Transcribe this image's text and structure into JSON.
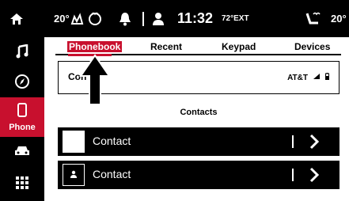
{
  "status": {
    "temp_left": "20°",
    "time": "11:32",
    "ext_temp": "72°EXT",
    "temp_right": "20°"
  },
  "sidebar": {
    "items": [
      {
        "icon": "music-note-icon",
        "label": ""
      },
      {
        "icon": "compass-icon",
        "label": ""
      },
      {
        "icon": "phone-icon",
        "label": "Phone",
        "active": true
      },
      {
        "icon": "car-icon",
        "label": ""
      },
      {
        "icon": "grid-icon",
        "label": ""
      }
    ]
  },
  "tabs": [
    "Phonebook",
    "Recent",
    "Keypad",
    "Devices"
  ],
  "device": {
    "name": "Con",
    "carrier": "AT&T"
  },
  "contacts": {
    "header": "Contacts",
    "rows": [
      {
        "name": "Contact"
      },
      {
        "name": "Contact"
      }
    ]
  },
  "colors": {
    "accent": "#c8102e",
    "bar": "#000000"
  }
}
